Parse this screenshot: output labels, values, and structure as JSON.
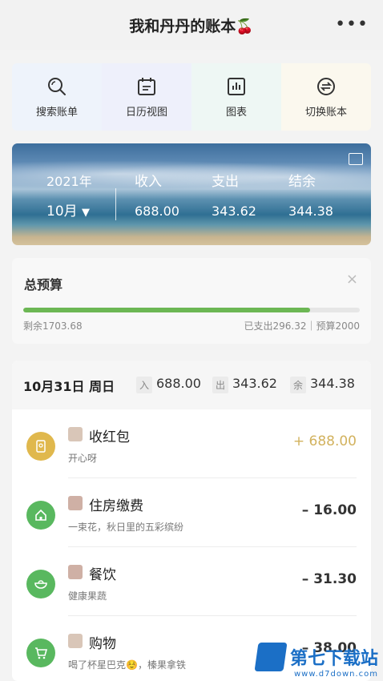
{
  "app": {
    "title": "我和丹丹的账本",
    "title_emoji": "🍒",
    "more": "•••"
  },
  "quick_actions": [
    {
      "label": "搜索账单",
      "icon": "search-icon",
      "bg": "#eef3fb"
    },
    {
      "label": "日历视图",
      "icon": "calendar-icon",
      "bg": "#eef0fb"
    },
    {
      "label": "图表",
      "icon": "chart-icon",
      "bg": "#eef7f4"
    },
    {
      "label": "切换账本",
      "icon": "switch-icon",
      "bg": "#fbf8ee"
    }
  ],
  "summary": {
    "year": "2021年",
    "month": "10月",
    "month_caret": "▼",
    "income_label": "收入",
    "expense_label": "支出",
    "balance_label": "结余",
    "income": "688.00",
    "expense": "343.62",
    "balance": "344.38"
  },
  "budget": {
    "title": "总预算",
    "close": "×",
    "remaining": "剩余1703.68",
    "spent_info": "已支出296.32｜预算2000",
    "progress": 0.852
  },
  "day": {
    "date": "10月31日 周日",
    "in_tag": "入",
    "in_value": "688.00",
    "out_tag": "出",
    "out_value": "343.62",
    "bal_tag": "余",
    "bal_value": "344.38"
  },
  "transactions": [
    {
      "name": "收红包",
      "note": "开心呀",
      "amount": "+ 688.00",
      "type": "income",
      "icon": "red-packet-icon",
      "color": "#e0b84d"
    },
    {
      "name": "住房缴费",
      "note": "一束花，秋日里的五彩缤纷",
      "amount": "– 16.00",
      "type": "expense",
      "icon": "house-icon",
      "color": "#59b85f"
    },
    {
      "name": "餐饮",
      "note": "健康果蔬",
      "amount": "– 31.30",
      "type": "expense",
      "icon": "bowl-icon",
      "color": "#59b85f"
    },
    {
      "name": "购物",
      "note": "喝了杯星巴克☺️，榛果拿铁",
      "amount": "– 38.00",
      "type": "expense",
      "icon": "cart-icon",
      "color": "#59b85f"
    }
  ],
  "watermark": {
    "title": "第七下载站",
    "url": "www.d7down.com"
  }
}
